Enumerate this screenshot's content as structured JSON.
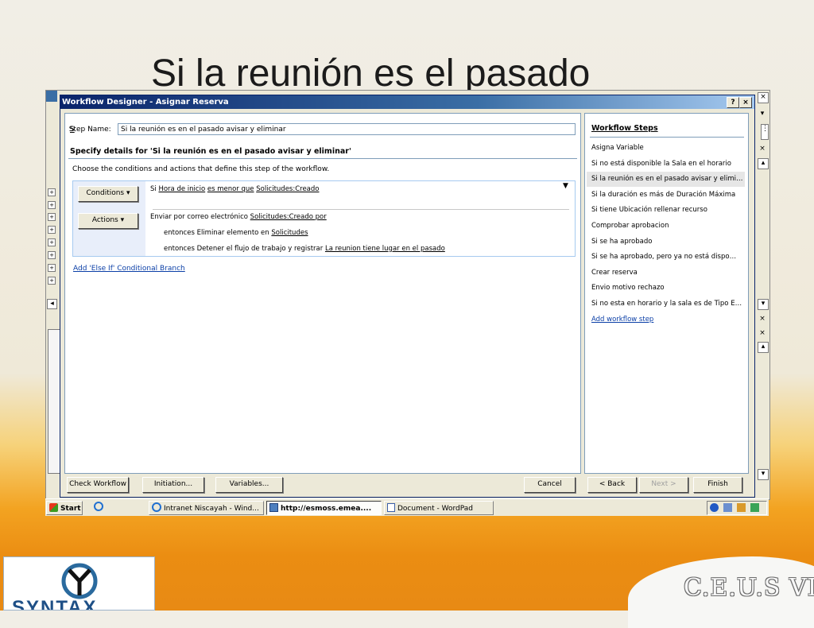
{
  "slide": {
    "title": "Si la reunión es el pasado"
  },
  "dialog": {
    "title": "Workflow Designer - Asignar Reserva",
    "help_btn": "?",
    "close_btn": "×",
    "step_name_label": "Step Name:",
    "step_name_value": "Si la reunión es en el pasado avisar y eliminar",
    "specify_heading": "Specify details for 'Si la reunión es en el pasado avisar y eliminar'",
    "choose_text": "Choose the conditions and actions that define this step of the workflow.",
    "conditions_button": "Conditions ▾",
    "actions_button": "Actions ▾",
    "condition": {
      "prefix": "Si",
      "field": "Hora de inicio",
      "operator": "es menor que",
      "value": "Solicitudes:Creado"
    },
    "actions": [
      {
        "text": "Enviar por correo electrónico",
        "link": "Solicitudes:Creado por"
      },
      {
        "text": "entonces Eliminar elemento en",
        "link": "Solicitudes"
      },
      {
        "text": "entonces Detener el flujo de trabajo y registrar",
        "link": "La reunion tiene lugar en el pasado"
      }
    ],
    "else_if_link": "Add 'Else If' Conditional Branch",
    "steps_title": "Workflow Steps",
    "steps": [
      "Asigna Variable",
      "Si no está disponible la Sala en el horario",
      "Si la reunión es en el pasado avisar y elimi…",
      "Si la duración es más de Duración Máxima",
      "Si tiene Ubicación rellenar recurso",
      "Comprobar aprobacion",
      "Si se ha aprobado",
      "Si se ha aprobado, pero ya no está dispo…",
      "Crear reserva",
      "Envio motivo rechazo",
      "Si no esta en horario y la sala es de Tipo E…"
    ],
    "selected_step_index": 2,
    "add_step_link": "Add workflow step",
    "buttons": {
      "check": "Check Workflow",
      "initiation": "Initiation...",
      "variables": "Variables...",
      "cancel": "Cancel",
      "back": "< Back",
      "next": "Next >",
      "finish": "Finish"
    }
  },
  "taskbar": {
    "start": "Start",
    "tasks": [
      "Intranet Niscayah - Wind...",
      "http://esmoss.emea....",
      "Document - WordPad"
    ]
  },
  "logos": {
    "syntax": "SYNTAX",
    "ceus": "C.E.U.S VI"
  }
}
